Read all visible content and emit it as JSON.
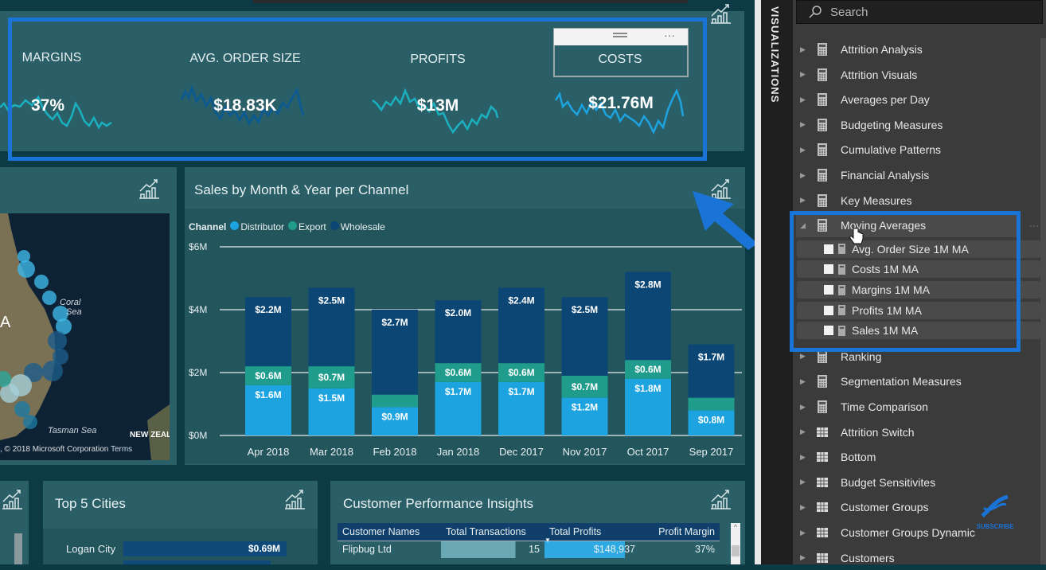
{
  "kpi_card": {
    "items": [
      {
        "title": "MARGINS",
        "value": "37%",
        "spark_color": "#1bb0bf"
      },
      {
        "title": "AVG. ORDER SIZE",
        "value": "$18.83K",
        "spark_color": "#0d5a8f"
      },
      {
        "title": "PROFITS",
        "value": "$13M",
        "spark_color": "#1bb0bf"
      },
      {
        "title": "COSTS",
        "value": "$21.76M",
        "spark_color": "#1ca3e0"
      }
    ],
    "more_options": "···"
  },
  "map_card": {
    "labels": [
      "Coral Sea",
      "Tasman Sea",
      "NEW ZEAL",
      "A"
    ],
    "copyright": ", © 2018 Microsoft Corporation",
    "terms": "Terms"
  },
  "sales_chart": {
    "title": "Sales by Month & Year per Channel"
  },
  "chart_data": {
    "type": "bar",
    "stacked": true,
    "title": "Sales by Month & Year per Channel",
    "legend_title": "Channel",
    "legend_position": "top-left",
    "categories": [
      "Apr 2018",
      "Mar 2018",
      "Feb 2018",
      "Jan 2018",
      "Dec 2017",
      "Nov 2017",
      "Oct 2017",
      "Sep 2017"
    ],
    "series": [
      {
        "name": "Distributor",
        "color": "#1ca3e0",
        "values": [
          1.6,
          1.5,
          0.9,
          1.7,
          1.7,
          1.2,
          1.8,
          0.8
        ],
        "labels": [
          "$1.6M",
          "$1.5M",
          "$0.9M",
          "$1.7M",
          "$1.7M",
          "$1.2M",
          "$1.8M",
          "$0.8M"
        ]
      },
      {
        "name": "Export",
        "color": "#1f9c8c",
        "values": [
          0.6,
          0.7,
          0.4,
          0.6,
          0.6,
          0.7,
          0.6,
          0.4
        ],
        "labels": [
          "$0.6M",
          "$0.7M",
          "",
          "$0.6M",
          "$0.6M",
          "$0.7M",
          "$0.6M",
          ""
        ]
      },
      {
        "name": "Wholesale",
        "color": "#0c4675",
        "values": [
          2.2,
          2.5,
          2.7,
          2.0,
          2.4,
          2.5,
          2.8,
          1.7
        ],
        "labels": [
          "$2.2M",
          "$2.5M",
          "$2.7M",
          "$2.0M",
          "$2.4M",
          "$2.5M",
          "$2.8M",
          "$1.7M"
        ]
      }
    ],
    "xlabel": "",
    "ylabel": "",
    "yticks": [
      "$0M",
      "$2M",
      "$4M",
      "$6M"
    ],
    "ylim": [
      0,
      6
    ],
    "grid": true
  },
  "top_cities": {
    "title": "Top 5 Cities",
    "rows": [
      {
        "city": "Logan City",
        "value": "$0.69M",
        "fraction": 1.0
      }
    ]
  },
  "customer_insights": {
    "title": "Customer Performance Insights",
    "columns": [
      "Customer Names",
      "Total Transactions",
      "Total Profits",
      "Profit Margin"
    ],
    "sort_indicator": "▼",
    "rows": [
      {
        "name": "Flipbug Ltd",
        "transactions": "15",
        "profits": "$148,937",
        "margin": "37%"
      }
    ]
  },
  "right_panel": {
    "tab_label": "VISUALIZATIONS",
    "search_placeholder": "Search",
    "fields": [
      {
        "name": "Attrition Analysis",
        "type": "measure-table",
        "expanded": false
      },
      {
        "name": "Attrition Visuals",
        "type": "measure-table",
        "expanded": false
      },
      {
        "name": "Averages per Day",
        "type": "measure-table",
        "expanded": false
      },
      {
        "name": "Budgeting Measures",
        "type": "measure-table",
        "expanded": false
      },
      {
        "name": "Cumulative Patterns",
        "type": "measure-table",
        "expanded": false
      },
      {
        "name": "Financial Analysis",
        "type": "measure-table",
        "expanded": false
      },
      {
        "name": "Key Measures",
        "type": "measure-table",
        "expanded": false
      },
      {
        "name": "Moving Averages",
        "type": "measure-table",
        "expanded": true
      },
      {
        "name": "Ranking",
        "type": "measure-table",
        "expanded": false
      },
      {
        "name": "Segmentation Measures",
        "type": "measure-table",
        "expanded": false
      },
      {
        "name": "Time Comparison",
        "type": "measure-table",
        "expanded": false
      },
      {
        "name": "Attrition Switch",
        "type": "table",
        "expanded": false
      },
      {
        "name": "Bottom",
        "type": "table",
        "expanded": false
      },
      {
        "name": "Budget Sensitivites",
        "type": "table",
        "expanded": false
      },
      {
        "name": "Customer Groups",
        "type": "table",
        "expanded": false
      },
      {
        "name": "Customer Groups Dynamic",
        "type": "table",
        "expanded": false
      },
      {
        "name": "Customers",
        "type": "table",
        "expanded": false
      }
    ],
    "moving_averages_children": [
      {
        "name": "Avg. Order Size 1M MA",
        "checked": false
      },
      {
        "name": "Costs 1M MA",
        "checked": false
      },
      {
        "name": "Margins 1M MA",
        "checked": false
      },
      {
        "name": "Profits 1M MA",
        "checked": false
      },
      {
        "name": "Sales 1M MA",
        "checked": false
      }
    ],
    "more_options": "···",
    "subscribe_label": "SUBSCRIBE"
  }
}
